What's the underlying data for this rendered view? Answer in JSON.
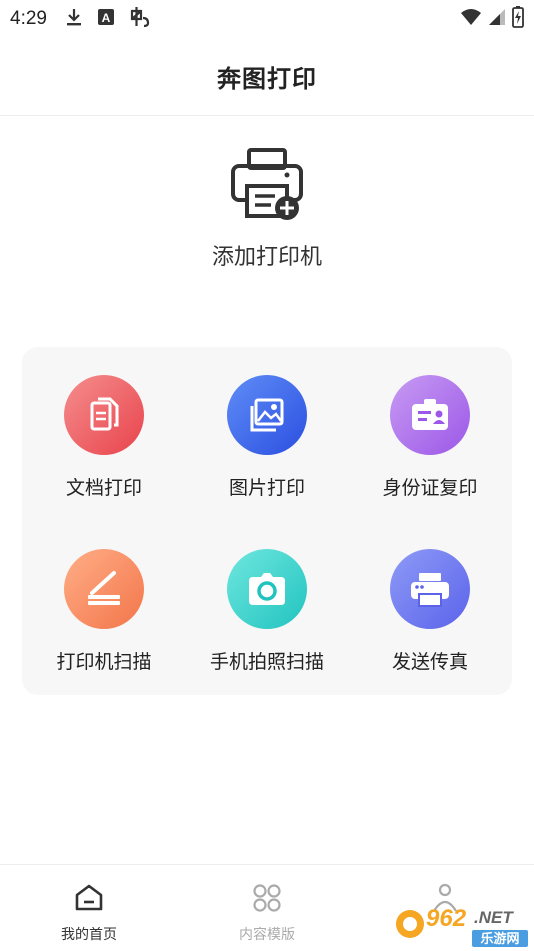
{
  "status_bar": {
    "time": "4:29",
    "left_icons": [
      "download-icon",
      "a-notification-icon",
      "app-notification-icon"
    ],
    "right_icons": [
      "wifi-icon",
      "signal-icon",
      "battery-icon"
    ]
  },
  "header": {
    "title": "奔图打印"
  },
  "add_printer": {
    "label": "添加打印机",
    "icon": "printer-add-icon"
  },
  "functions": [
    {
      "label": "文档打印",
      "icon": "document-icon",
      "color_from": "#f58e8e",
      "color_to": "#e8434b"
    },
    {
      "label": "图片打印",
      "icon": "image-icon",
      "color_from": "#5f8df7",
      "color_to": "#2b4fe0"
    },
    {
      "label": "身份证复印",
      "icon": "id-card-icon",
      "color_from": "#c79bf2",
      "color_to": "#9c57e8"
    },
    {
      "label": "打印机扫描",
      "icon": "scanner-icon",
      "color_from": "#ffae87",
      "color_to": "#f3754a"
    },
    {
      "label": "手机拍照扫描",
      "icon": "camera-icon",
      "color_from": "#6ee7df",
      "color_to": "#22c3bf"
    },
    {
      "label": "发送传真",
      "icon": "fax-icon",
      "color_from": "#8e9bf7",
      "color_to": "#5b63ea"
    }
  ],
  "tabs": [
    {
      "label": "我的首页",
      "icon": "home-icon",
      "active": true
    },
    {
      "label": "内容模版",
      "icon": "template-grid-icon",
      "active": false
    },
    {
      "label": "",
      "icon": "profile-icon",
      "active": false
    }
  ],
  "colors": {
    "tab_active": "#333333",
    "tab_inactive": "#aaaaaa",
    "panel_bg": "#f7f7f7"
  },
  "watermark": {
    "text_top": "962.NET",
    "text_bottom": "乐游网"
  }
}
